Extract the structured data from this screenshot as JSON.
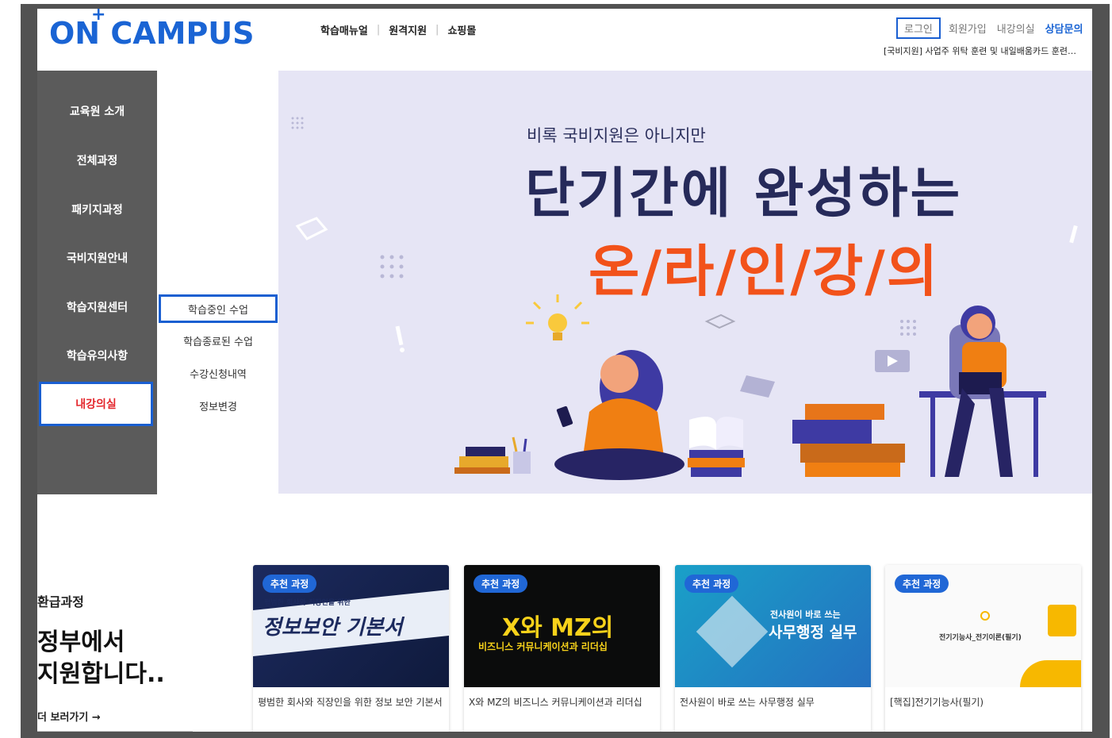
{
  "logo": {
    "text": "ON CAMPUS",
    "plus": "+"
  },
  "top_nav": [
    "학습매뉴얼",
    "원격지원",
    "쇼핑몰"
  ],
  "util_nav": {
    "login": "로그인",
    "signup": "회원가입",
    "classroom": "내강의실",
    "consult": "상담문의"
  },
  "notice": "[국비지원] 사업주 위탁 훈련 및 내일배움카드 훈련…",
  "sidebar": {
    "items": [
      {
        "label": "교육원 소개"
      },
      {
        "label": "전체과정"
      },
      {
        "label": "패키지과정"
      },
      {
        "label": "국비지원안내"
      },
      {
        "label": "학습지원센터"
      },
      {
        "label": "학습유의사항"
      },
      {
        "label": "내강의실"
      }
    ],
    "active_index": 6
  },
  "submenu": {
    "items": [
      {
        "label": "학습중인 수업"
      },
      {
        "label": "학습종료된 수업"
      },
      {
        "label": "수강신청내역"
      },
      {
        "label": "정보변경"
      }
    ],
    "active_index": 0
  },
  "banner": {
    "subtitle": "비록 국비지원은 아니지만",
    "title": "단기간에 완성하는",
    "highlight": "온/라/인/강/의"
  },
  "promo": {
    "category": "환급과정",
    "headline_1": "정부에서",
    "headline_2": "지원합니다..",
    "more": "더 보러가기 →"
  },
  "cards": [
    {
      "badge": "추천 과정",
      "image_text_1": "평범한 회사와 직장인을 위한",
      "image_text_2": "정보보안 기본서",
      "caption": "평범한 회사와 직장인을 위한 정보 보안 기본서"
    },
    {
      "badge": "추천 과정",
      "image_text_1": "X와 MZ의",
      "image_text_2": "비즈니스 커뮤니케이션과 리더십",
      "caption": "X와 MZ의 비즈니스 커뮤니케이션과 리더십"
    },
    {
      "badge": "추천 과정",
      "image_text_1": "전사원이 바로 쓰는",
      "image_text_2": "사무행정 실무",
      "caption": "전사원이 바로 쓰는 사무행정 실무"
    },
    {
      "badge": "추천 과정",
      "image_text_1": "전기기능사_전기이론(필기)",
      "image_text_2": "",
      "caption": "[핵집]전기기능사(필기)"
    }
  ],
  "colors": {
    "brand": "#1a64d4",
    "highlight": "#f2521a",
    "sidebar": "#5b5b5b",
    "banner_bg": "#e6e5f5",
    "active_red": "#e4262c"
  }
}
